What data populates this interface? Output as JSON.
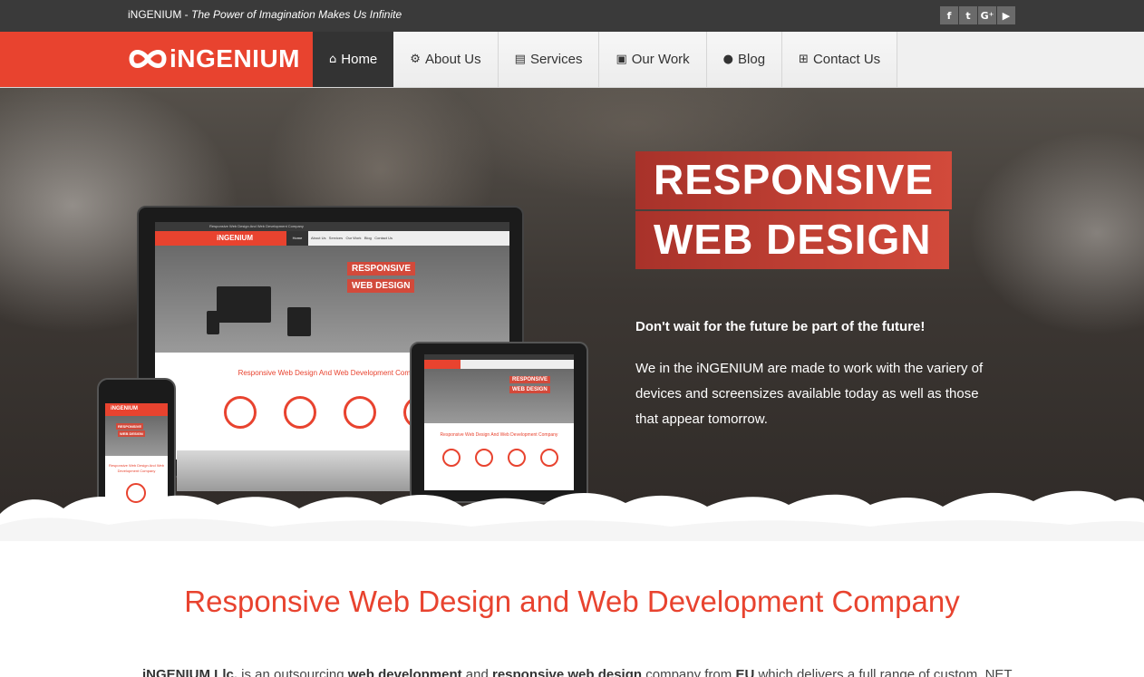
{
  "topbar": {
    "brand": "iNGENIUM",
    "separator": " - ",
    "slogan": "The Power of Imagination Makes Us Infinite",
    "social": [
      {
        "icon": "facebook-icon",
        "glyph": "f"
      },
      {
        "icon": "twitter-icon",
        "glyph": "t"
      },
      {
        "icon": "google-plus-icon",
        "glyph": "G⁺"
      },
      {
        "icon": "youtube-icon",
        "glyph": "▶"
      }
    ]
  },
  "logo": {
    "text": "iNGENIUM",
    "icon": "infinity-logo-icon"
  },
  "nav": {
    "items": [
      {
        "label": "Home",
        "icon": "home-icon",
        "glyph": "⌂",
        "active": true
      },
      {
        "label": "About Us",
        "icon": "gear-icon",
        "glyph": "⚙"
      },
      {
        "label": "Services",
        "icon": "book-icon",
        "glyph": "▤"
      },
      {
        "label": "Our Work",
        "icon": "briefcase-icon",
        "glyph": "▣"
      },
      {
        "label": "Blog",
        "icon": "comments-icon",
        "glyph": "●"
      },
      {
        "label": "Contact Us",
        "icon": "cart-icon",
        "glyph": "⊞"
      }
    ]
  },
  "hero": {
    "headline_line1": "RESPONSIVE",
    "headline_line2": "WEB DESIGN",
    "lead": "Don't wait for the future be part of the future!",
    "body": "We in the iNGENIUM are made to work with the variery of devices and screensizes available today as well as those that appear tomorrow."
  },
  "mockup": {
    "monitor_title": "Responsive Web Design And Web Development Company",
    "monitor_nav": [
      "Home",
      "About Us",
      "Services",
      "Our Work",
      "Blog",
      "Contact Us"
    ],
    "tagline": "Responsive Web Design And Web Development Company",
    "phone_tagline": "Responsive Web Design And Web Development Company"
  },
  "main": {
    "title": "Responsive Web Design and Web Development Company",
    "intro_parts": {
      "brand": "iNGENIUM Llc.",
      "t1": " is an outsourcing ",
      "k1": "web development",
      "t2": " and ",
      "k2": "responsive web design",
      "t3": " company from ",
      "k3": "EU",
      "t4": " which delivers a full range of custom .NET"
    }
  },
  "colors": {
    "accent": "#e8432f",
    "topbar": "#3a3a3a",
    "nav_active": "#333333",
    "headline_bg": "#c0392b"
  }
}
